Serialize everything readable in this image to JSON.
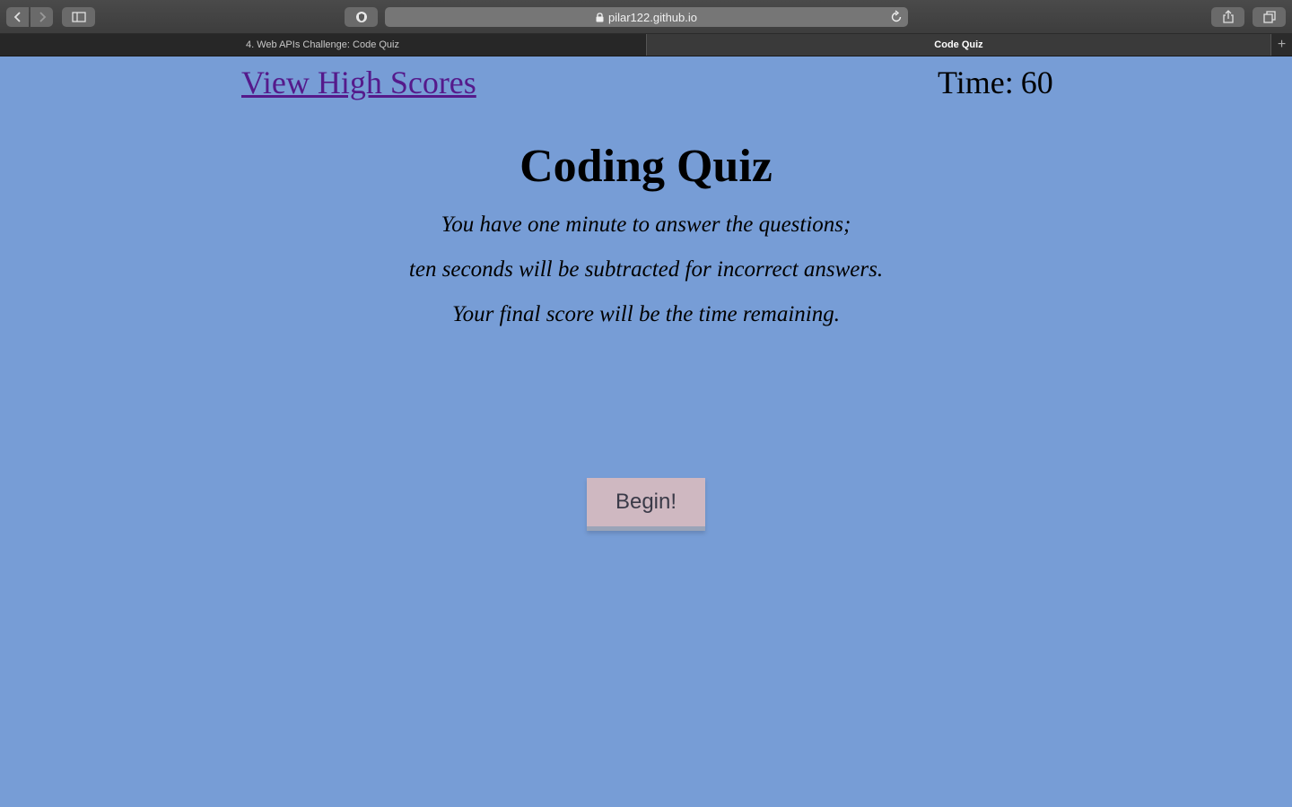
{
  "browser": {
    "url": "pilar122.github.io",
    "tabs": [
      {
        "label": "4. Web APIs Challenge: Code Quiz",
        "active": false
      },
      {
        "label": "Code Quiz",
        "active": true
      }
    ],
    "new_tab_label": "+"
  },
  "header": {
    "high_scores_link": "View High Scores",
    "timer_label": "Time:",
    "timer_value": "60"
  },
  "main": {
    "title": "Coding Quiz",
    "instructions": [
      "You have one minute to answer the questions;",
      "ten seconds will be subtracted for incorrect answers.",
      "Your final score will be the time remaining."
    ],
    "begin_button": "Begin!"
  },
  "colors": {
    "page_background": "#779dd6",
    "link": "#551a8b",
    "button_background": "#cfb8c1"
  },
  "icons": [
    "back-icon",
    "forward-icon",
    "sidebar-icon",
    "shield-icon",
    "lock-icon",
    "reload-icon",
    "share-icon",
    "tabs-overview-icon"
  ]
}
